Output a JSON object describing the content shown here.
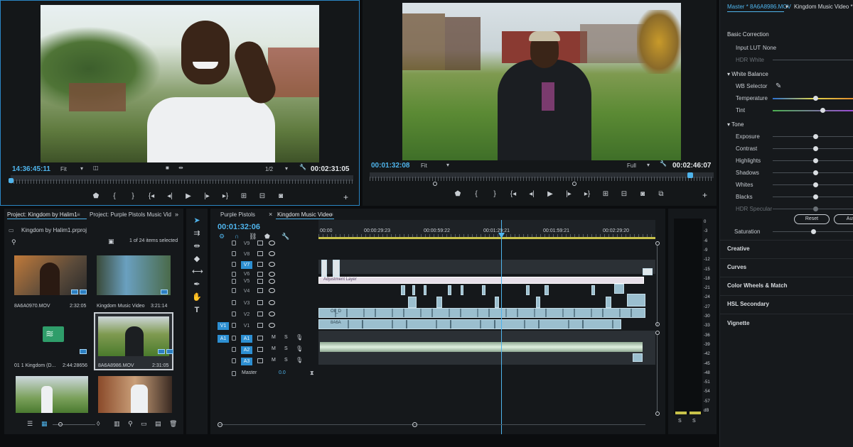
{
  "source": {
    "timecode_in": "14:36:45:11",
    "fit": "Fit",
    "resolution": "1/2",
    "timecode_out": "00:02:31:05"
  },
  "program": {
    "timecode_in": "00:01:32:08",
    "fit": "Fit",
    "resolution": "Full",
    "timecode_out": "00:02:46:07"
  },
  "lumetri": {
    "tab_master": "Master * 8A6A8986.MOV",
    "tab_sequence": "Kingdom Music Video *",
    "basic_correction": "Basic Correction",
    "input_lut_label": "Input LUT",
    "input_lut_value": "None",
    "hdr_white": "HDR White",
    "white_balance": "White Balance",
    "wb_selector": "WB Selector",
    "temperature": "Temperature",
    "tint": "Tint",
    "tone": "Tone",
    "exposure": "Exposure",
    "contrast": "Contrast",
    "highlights": "Highlights",
    "shadows": "Shadows",
    "whites": "Whites",
    "blacks": "Blacks",
    "hdr_specular": "HDR Specular",
    "reset": "Reset",
    "auto": "Auto",
    "saturation": "Saturation",
    "sections": [
      "Creative",
      "Curves",
      "Color Wheels & Match",
      "HSL Secondary",
      "Vignette"
    ]
  },
  "project": {
    "tab_1": "Project: Kingdom by Halim1",
    "tab_2": "Project: Purple Pistols Music Vid",
    "file": "Kingdom by Halim1.prproj",
    "selection_info": "1 of 24 items selected",
    "items": [
      {
        "name": "8A6A0970.MOV",
        "duration": "2:32:05"
      },
      {
        "name": "Kingdom Music Video",
        "duration": "3:21:14"
      },
      {
        "name": "01 1 Kingdom (D...",
        "duration": "2:44:28656"
      },
      {
        "name": "8A6A8986.MOV",
        "duration": "2:31:05"
      }
    ]
  },
  "timeline": {
    "tab_1": "Purple Pistols",
    "tab_2": "Kingdom Music Video",
    "timecode": "00:01:32:06",
    "ruler": [
      "00:00",
      "00:00:29:23",
      "00:00:59:22",
      "00:01:29:21",
      "00:01:59:21",
      "00:02:29:20"
    ],
    "video_tracks": [
      "V9",
      "V8",
      "V7",
      "V6",
      "V5",
      "V4",
      "V3",
      "V2",
      "V1"
    ],
    "audio_tracks": [
      "A1",
      "A2",
      "A3"
    ],
    "src_v1": "V1",
    "src_a1": "A1",
    "master": "Master",
    "master_value": "0.0",
    "adjustment_layer": "Adjustment Layer",
    "clip_v2": "Oli_D",
    "clip_v1": "8A6A",
    "mute": "M",
    "solo": "S"
  },
  "meters": {
    "scale": [
      "0",
      "-3",
      "-6",
      "-9",
      "-12",
      "-15",
      "-18",
      "-21",
      "-24",
      "-27",
      "-30",
      "-33",
      "-36",
      "-39",
      "-42",
      "-45",
      "-48",
      "-51",
      "-54",
      "-57",
      "dB"
    ],
    "solo_left": "S",
    "solo_right": "S"
  }
}
